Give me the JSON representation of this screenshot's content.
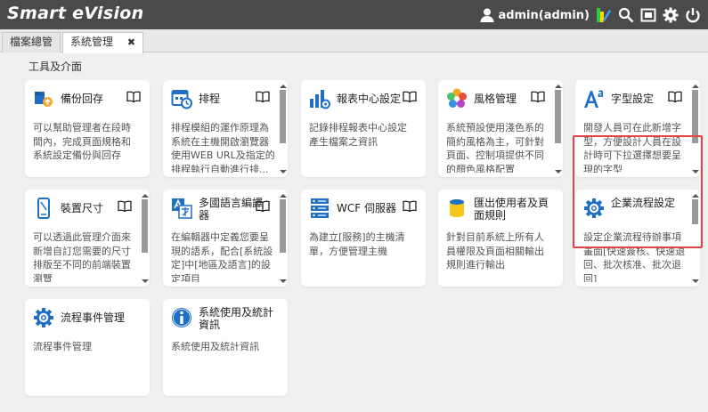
{
  "app": {
    "title": "Smart eVision",
    "user": "admin(admin)"
  },
  "header_icons": [
    "user-icon",
    "edit-color-icon",
    "search-icon",
    "fullscreen-icon",
    "settings-icon",
    "power-icon"
  ],
  "tabs": [
    {
      "label": "檔案總管",
      "active": false
    },
    {
      "label": "系統管理",
      "active": true,
      "close": "✖"
    }
  ],
  "section": {
    "title": "工具及介面"
  },
  "cards": [
    {
      "title": "備份回存",
      "icon": "backup-icon",
      "desc": "可以幫助管理者在段時間內，完成頁面規格和系統設定備份與回存"
    },
    {
      "title": "排程",
      "icon": "schedule-icon",
      "desc": "排程模組的運作原理為系統在主機開啟瀏覽器使用WEB URL及指定的排程執行自動進行排...",
      "scroll": true
    },
    {
      "title": "報表中心設定",
      "icon": "report-center-icon",
      "desc": "記錄排程報表中心設定產生檔案之資訊"
    },
    {
      "title": "風格管理",
      "icon": "theme-icon",
      "desc": "系統預設使用淺色系的簡約風格為主，可針對頁面、控制項提供不同的顏色風格配置",
      "scroll": true
    },
    {
      "title": "字型設定",
      "icon": "font-icon",
      "desc": "開發人員可在此新增字型，方便設計人員在設計時可下拉選擇想要呈現的字型",
      "scroll": true
    },
    {
      "title": "裝置尺寸",
      "icon": "device-icon",
      "desc": "可以透過此管理介面來新增自訂您需要的尺寸排版至不同的前端裝置瀏覽",
      "scroll": true
    },
    {
      "title": "多國語言編譯器",
      "icon": "translate-icon",
      "desc": "在編輯器中定義您要呈現的語系，配合[系統設定]中[地區及語言]的設定項目",
      "scroll": true
    },
    {
      "title": "WCF 伺服器",
      "icon": "server-icon",
      "desc": "為建立[服務]的主機清單，方便管理主機"
    },
    {
      "title": "匯出使用者及頁面規則",
      "icon": "export-icon",
      "desc": "針對目前系統上所有人員權限及頁面相關輸出規則進行輸出"
    },
    {
      "title": "企業流程設定",
      "icon": "gear-icon",
      "desc": "設定企業流程待辦事項畫面[快速簽核、快速退回、批次核准、批次退回]",
      "scroll": true,
      "highlighted": true
    },
    {
      "title": "流程事件管理",
      "icon": "gear-icon",
      "desc": "流程事件管理"
    },
    {
      "title": "系統使用及統計資訊",
      "icon": "info-icon",
      "desc": "系統使用及統計資訊"
    }
  ],
  "colors": {
    "topbar": "#4a4a4a",
    "highlight": "#e34444",
    "accent_blue": "#1f6fc5"
  }
}
